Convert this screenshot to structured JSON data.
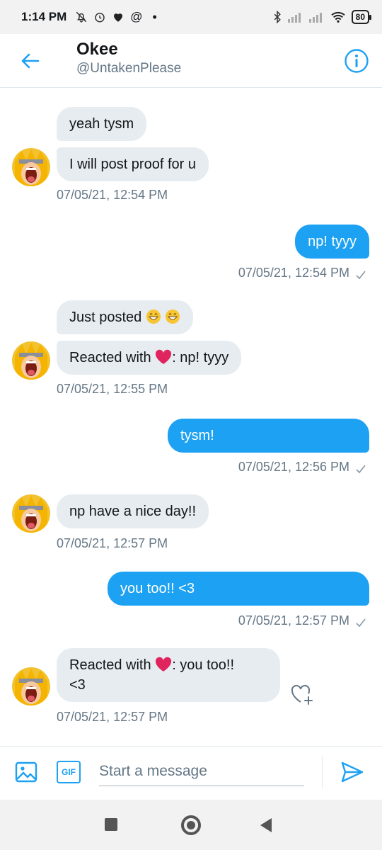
{
  "status_bar": {
    "time": "1:14 PM",
    "at_symbol": "@",
    "dot": "•",
    "battery": "80",
    "icons": [
      "mute-icon",
      "alarm-icon",
      "heart-icon",
      "at-icon",
      "bluetooth-icon",
      "signal-icon",
      "signal-icon",
      "wifi-icon",
      "battery-icon"
    ]
  },
  "header": {
    "title": "Okee",
    "handle": "@UntakenPlease",
    "back_icon": "back-arrow-icon",
    "info_icon": "info-icon"
  },
  "messages": [
    {
      "direction": "in",
      "text": "yeah tysm"
    },
    {
      "direction": "in",
      "text": "I will post proof for u"
    },
    {
      "direction": "in",
      "timestamp": "07/05/21, 12:54 PM"
    },
    {
      "direction": "out",
      "text": "np! tyyy",
      "timestamp": "07/05/21, 12:54 PM"
    },
    {
      "direction": "in",
      "text": "Just posted"
    },
    {
      "direction": "in",
      "reaction_prefix": "Reacted with",
      "reaction_suffix": ": np! tyyy"
    },
    {
      "direction": "in",
      "timestamp": "07/05/21, 12:55 PM"
    },
    {
      "direction": "out",
      "text": "tysm!",
      "timestamp": "07/05/21, 12:56 PM"
    },
    {
      "direction": "in",
      "text": "np have a nice day!!",
      "timestamp": "07/05/21, 12:57 PM"
    },
    {
      "direction": "out",
      "text": "you too!! <3",
      "timestamp": "07/05/21, 12:57 PM"
    },
    {
      "direction": "in",
      "reaction_prefix": "Reacted with",
      "reaction_suffix": ": you too!!",
      "reaction_line2": "<3",
      "timestamp": "07/05/21, 12:57 PM"
    }
  ],
  "composer": {
    "placeholder": "Start a message",
    "gif_label": "GIF",
    "media_icon": "image-icon",
    "send_icon": "send-icon"
  },
  "colors": {
    "accent": "#1da1f2",
    "incoming_bubble": "#e6ecf0",
    "muted_text": "#657786",
    "heart": "#e0245e"
  }
}
